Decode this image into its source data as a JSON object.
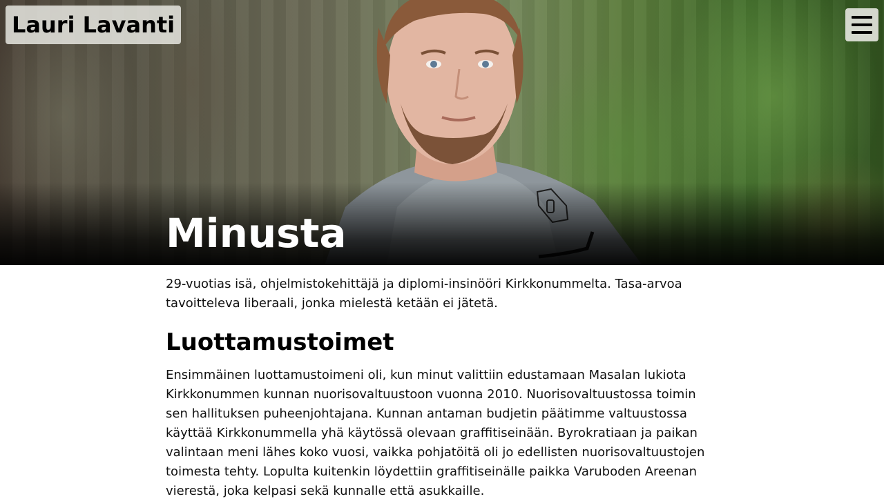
{
  "header": {
    "site_title": "Lauri Lavanti",
    "menu_icon": "hamburger-menu-icon"
  },
  "hero": {
    "heading": "Minusta"
  },
  "main": {
    "intro": "29-vuotias isä, ohjelmistokehittäjä ja diplomi-insinööri Kirkkonummelta. Tasa-arvoa tavoitteleva liberaali, jonka mielestä ketään ei jätetä.",
    "section_heading": "Luottamustoimet",
    "section_text": "Ensimmäinen luottamustoimeni oli, kun minut valittiin edustamaan Masalan lukiota Kirkkonummen kunnan nuorisovaltuustoon vuonna 2010. Nuorisovaltuustossa toimin sen hallituksen puheenjohtajana. Kunnan antaman budjetin päätimme valtuustossa käyttää Kirkkonummella yhä käytössä olevaan graffitiseinään. Byrokratiaan ja paikan valintaan meni lähes koko vuosi, vaikka pohjatöitä oli jo edellisten nuorisovaltuustojen toimesta tehty. Lopulta kuitenkin löydettiin graffitiseinälle paikka Varuboden Areenan vierestä, joka kelpasi sekä kunnalle että asukkaille."
  },
  "colors": {
    "hero_text": "#ffffff",
    "body_text": "#111111",
    "title_bg": "#e6e6e1"
  }
}
